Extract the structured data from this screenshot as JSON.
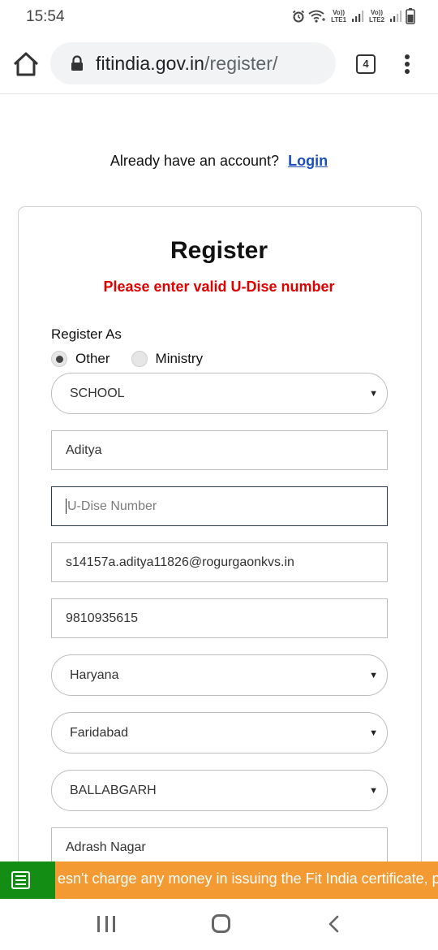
{
  "status_bar": {
    "time": "15:54",
    "network1": "LTE1",
    "network2": "LTE2",
    "volte": "Vo))"
  },
  "browser": {
    "url_host": "fitindia.gov.in",
    "url_path": "/register/",
    "tab_count": "4"
  },
  "page": {
    "account_question": "Already have an account?",
    "login_label": "Login",
    "title": "Register",
    "error_message": "Please enter valid U-Dise number",
    "register_as_label": "Register As",
    "radio_options": [
      "Other",
      "Ministry"
    ],
    "selected_radio": "Other",
    "fields": {
      "category": "SCHOOL",
      "name": "Aditya",
      "udise_placeholder": "U-Dise Number",
      "email": "s14157a.aditya11826@rogurgaonkvs.in",
      "phone": "9810935615",
      "state": "Haryana",
      "district": "Faridabad",
      "block": "BALLABGARH",
      "address": "Adrash Nagar"
    }
  },
  "banner": {
    "text": "esn't charge any money in issuing the Fit India certificate, p"
  },
  "colors": {
    "error": "#e00000",
    "link": "#1a4fba",
    "banner_bg": "#f49a32",
    "banner_icon_bg": "#148d14"
  }
}
